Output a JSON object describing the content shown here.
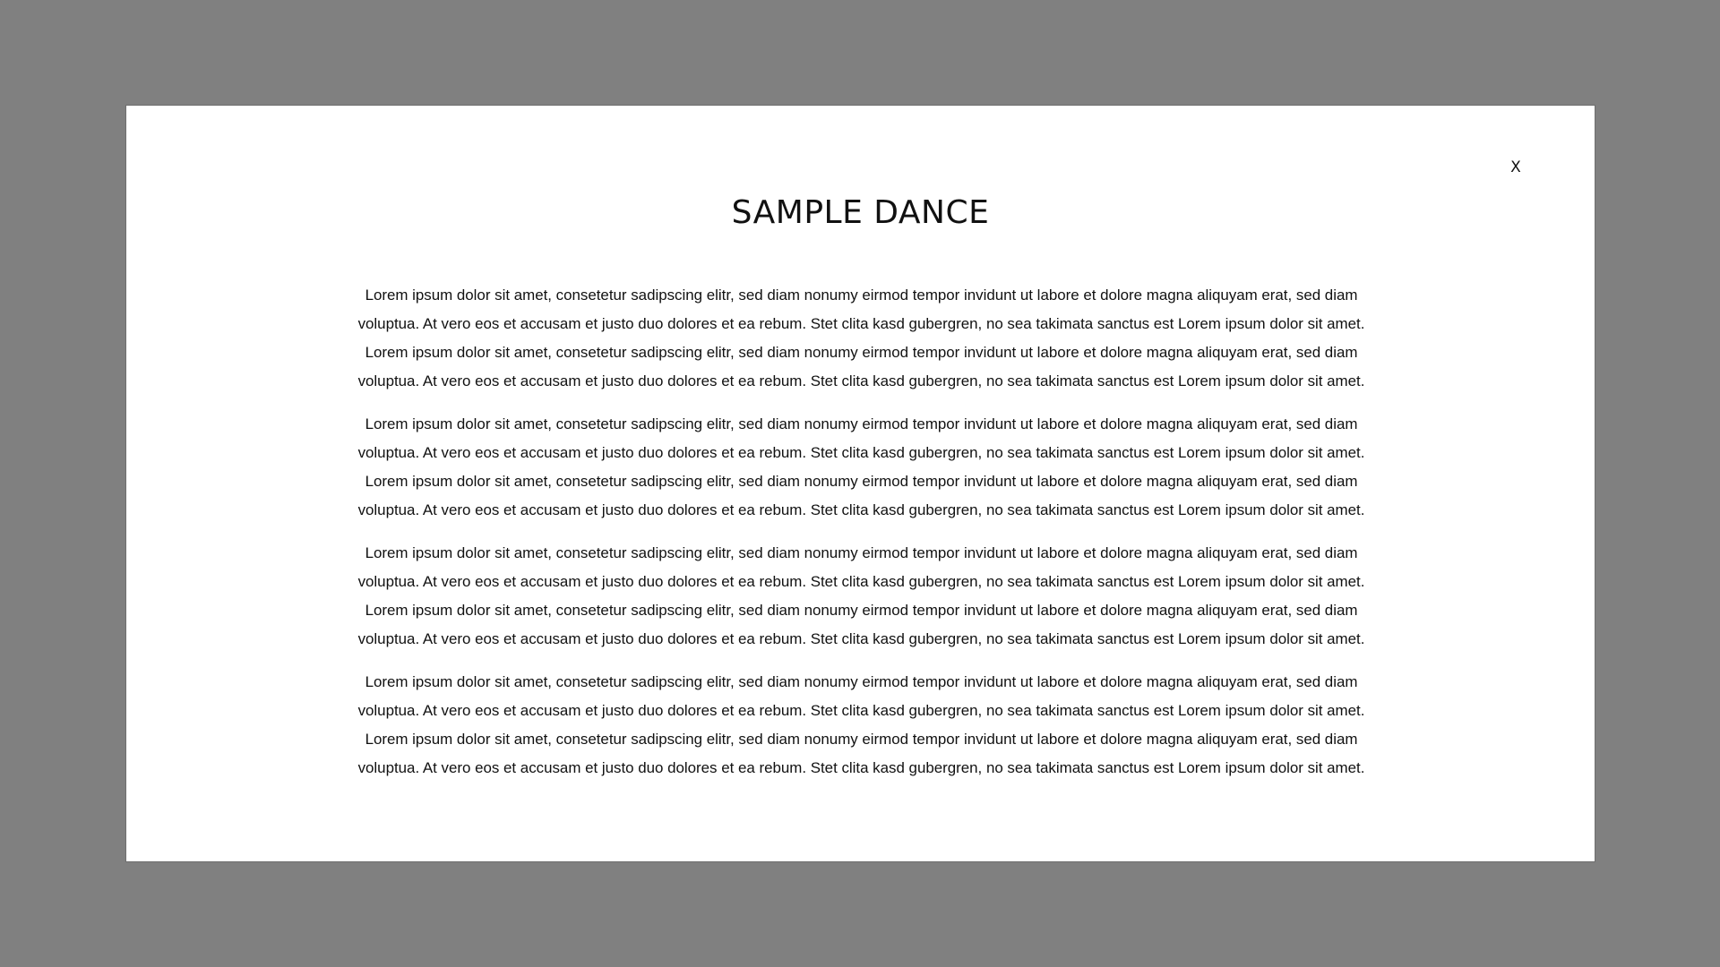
{
  "modal": {
    "close_label": "X",
    "title": "SAMPLE DANCE",
    "paragraphs": [
      "Lorem ipsum dolor sit amet, consetetur sadipscing elitr, sed diam nonumy eirmod tempor invidunt ut labore et dolore magna aliquyam erat, sed diam voluptua. At vero eos et accusam et justo duo dolores et ea rebum. Stet clita kasd gubergren, no sea takimata sanctus est Lorem ipsum dolor sit amet. Lorem ipsum dolor sit amet, consetetur sadipscing elitr, sed diam nonumy eirmod tempor invidunt ut labore et dolore magna aliquyam erat, sed diam voluptua. At vero eos et accusam et justo duo dolores et ea rebum. Stet clita kasd gubergren, no sea takimata sanctus est Lorem ipsum dolor sit amet.",
      "Lorem ipsum dolor sit amet, consetetur sadipscing elitr, sed diam nonumy eirmod tempor invidunt ut labore et dolore magna aliquyam erat, sed diam voluptua. At vero eos et accusam et justo duo dolores et ea rebum. Stet clita kasd gubergren, no sea takimata sanctus est Lorem ipsum dolor sit amet. Lorem ipsum dolor sit amet, consetetur sadipscing elitr, sed diam nonumy eirmod tempor invidunt ut labore et dolore magna aliquyam erat, sed diam voluptua. At vero eos et accusam et justo duo dolores et ea rebum. Stet clita kasd gubergren, no sea takimata sanctus est Lorem ipsum dolor sit amet.",
      "Lorem ipsum dolor sit amet, consetetur sadipscing elitr, sed diam nonumy eirmod tempor invidunt ut labore et dolore magna aliquyam erat, sed diam voluptua. At vero eos et accusam et justo duo dolores et ea rebum. Stet clita kasd gubergren, no sea takimata sanctus est Lorem ipsum dolor sit amet. Lorem ipsum dolor sit amet, consetetur sadipscing elitr, sed diam nonumy eirmod tempor invidunt ut labore et dolore magna aliquyam erat, sed diam voluptua. At vero eos et accusam et justo duo dolores et ea rebum. Stet clita kasd gubergren, no sea takimata sanctus est Lorem ipsum dolor sit amet.",
      "Lorem ipsum dolor sit amet, consetetur sadipscing elitr, sed diam nonumy eirmod tempor invidunt ut labore et dolore magna aliquyam erat, sed diam voluptua. At vero eos et accusam et justo duo dolores et ea rebum. Stet clita kasd gubergren, no sea takimata sanctus est Lorem ipsum dolor sit amet. Lorem ipsum dolor sit amet, consetetur sadipscing elitr, sed diam nonumy eirmod tempor invidunt ut labore et dolore magna aliquyam erat, sed diam voluptua. At vero eos et accusam et justo duo dolores et ea rebum. Stet clita kasd gubergren, no sea takimata sanctus est Lorem ipsum dolor sit amet."
    ]
  },
  "colors": {
    "overlay": "#808080",
    "modal_background": "#ffffff",
    "text": "#111111"
  }
}
